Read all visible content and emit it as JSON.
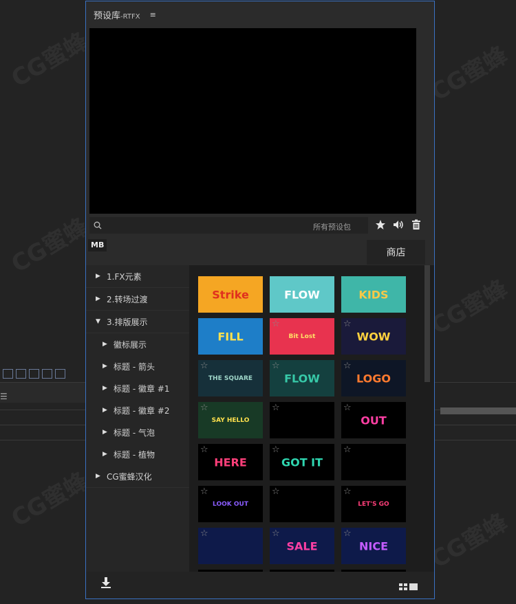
{
  "panel": {
    "title": "预设库",
    "title_suffix": "-RTFX"
  },
  "search": {
    "placeholder": "",
    "filter_label": "所有预设包"
  },
  "collection_tag": "MB",
  "store_label": "商店",
  "tree": [
    {
      "label": "1.FX元素",
      "level": 1,
      "arrow": "▶"
    },
    {
      "label": "2.转场过渡",
      "level": 1,
      "arrow": "▶"
    },
    {
      "label": "3.排版展示",
      "level": 1,
      "arrow": "▼"
    },
    {
      "label": "徽标展示",
      "level": 2,
      "arrow": "▶"
    },
    {
      "label": "标题 - 箭头",
      "level": 2,
      "arrow": "▶"
    },
    {
      "label": "标题 - 徽章 #1",
      "level": 2,
      "arrow": "▶"
    },
    {
      "label": "标题 - 徽章 #2",
      "level": 2,
      "arrow": "▶"
    },
    {
      "label": "标题 - 气泡",
      "level": 2,
      "arrow": "▶"
    },
    {
      "label": "标题 - 植物",
      "level": 2,
      "arrow": "▶"
    },
    {
      "label": "CG蜜蜂汉化",
      "level": 1,
      "arrow": "▶"
    }
  ],
  "thumbnails": [
    {
      "label": "Strike",
      "bg": "#f5a623",
      "fg": "#e0301e"
    },
    {
      "label": "FLOW",
      "bg": "#5fc8c8",
      "fg": "#ffffff"
    },
    {
      "label": "KIDS",
      "bg": "#3fb6a8",
      "fg": "#f7c948"
    },
    {
      "label": "FILL",
      "bg": "#1e7ec8",
      "fg": "#ffe14d"
    },
    {
      "label": "Bit Lost",
      "bg": "#e8334f",
      "fg": "#ffe066"
    },
    {
      "label": "WOW",
      "bg": "#1a1a3a",
      "fg": "#ffd23f"
    },
    {
      "label": "THE SQUARE",
      "bg": "#16303a",
      "fg": "#9fd6c9"
    },
    {
      "label": "FLOW",
      "bg": "#14403f",
      "fg": "#37c9a8"
    },
    {
      "label": "LOGO",
      "bg": "#0e1626",
      "fg": "#ff7a2f"
    },
    {
      "label": "SAY HELLO",
      "bg": "#183a26",
      "fg": "#ffe14d"
    },
    {
      "label": "",
      "bg": "#000000",
      "fg": "#e0309a"
    },
    {
      "label": "OUT",
      "bg": "#000000",
      "fg": "#ff3fa4"
    },
    {
      "label": "HERE",
      "bg": "#000000",
      "fg": "#ff3f7a"
    },
    {
      "label": "GOT IT",
      "bg": "#000000",
      "fg": "#2fd6b0"
    },
    {
      "label": "",
      "bg": "#000000",
      "fg": "#3fb6ff"
    },
    {
      "label": "LOOK OUT",
      "bg": "#000000",
      "fg": "#8a5cff"
    },
    {
      "label": "",
      "bg": "#000000",
      "fg": "#ffd23f"
    },
    {
      "label": "LET'S GO",
      "bg": "#000000",
      "fg": "#ff3f7a"
    },
    {
      "label": "",
      "bg": "#0e1a4a",
      "fg": "#8a5cff"
    },
    {
      "label": "SALE",
      "bg": "#0e1a4a",
      "fg": "#ff3fa4"
    },
    {
      "label": "NICE",
      "bg": "#0e1a4a",
      "fg": "#c45cff"
    }
  ],
  "colors": {
    "accent_border": "#3a72c4",
    "panel_bg": "#2b2b2b"
  },
  "icons": {
    "favorite": "star-icon",
    "audio": "speaker-icon",
    "delete": "trash-icon",
    "download": "download-icon",
    "view": "grid-view-icon"
  },
  "watermark": "CG蜜蜂"
}
